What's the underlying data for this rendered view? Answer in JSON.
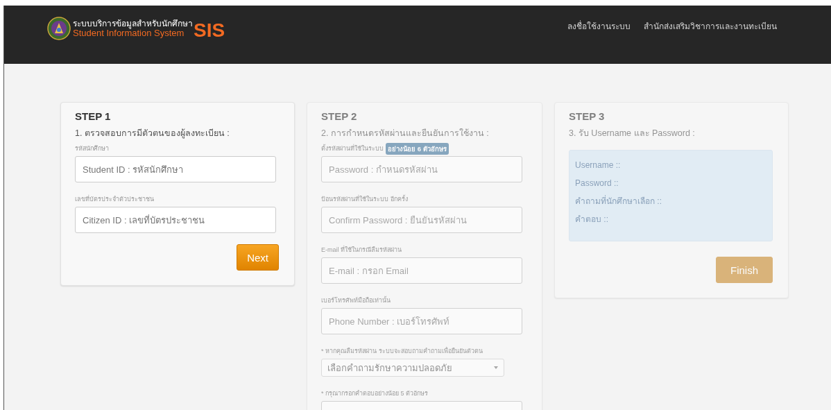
{
  "header": {
    "logo": {
      "title_th": "ระบบบริการข้อมูลสำหรับนักศึกษา",
      "title_en": "Student Information System",
      "acronym": "SIS"
    },
    "nav": [
      {
        "label": "ลงชื่อใช้งานระบบ"
      },
      {
        "label": "สำนักส่งเสริมวิชาการและงานทะเบียน"
      }
    ]
  },
  "steps": [
    {
      "title": "STEP 1",
      "subtitle": "1. ตรวจสอบการมีตัวตนของผู้ลงทะเบียน :",
      "disabled": false,
      "items": [
        {
          "kind": "input",
          "label": "รหัสนักศึกษา",
          "placeholder": "Student ID : รหัสนักศึกษา"
        },
        {
          "kind": "input",
          "label": "เลขที่บัตรประจำตัวประชาชน",
          "placeholder": "Citizen ID : เลขที่บัตรประชาชน"
        }
      ],
      "button": "Next"
    },
    {
      "title": "STEP 2",
      "subtitle": "2. การกำหนดรหัสผ่านและยืนยันการใช้งาน :",
      "disabled": true,
      "items": [
        {
          "kind": "input",
          "label": "ตั้งรหัสผ่านที่ใช้ในระบบ",
          "badge": "อย่างน้อย 6 ตัวอักษร",
          "placeholder": "Password : กำหนดรหัสผ่าน"
        },
        {
          "kind": "input",
          "label": "ป้อนรหัสผ่านที่ใช้ในระบบ อีกครั้ง",
          "placeholder": "Confirm Password : ยืนยันรหัสผ่าน"
        },
        {
          "kind": "input",
          "label": "E-mail ที่ใช้ในกรณีลืมรหัสผ่าน",
          "placeholder": "E-mail : กรอก Email"
        },
        {
          "kind": "input",
          "label": "เบอร์โทรศัพท์มือถือเท่านั้น",
          "placeholder": "Phone Number : เบอร์โทรศัพท์"
        },
        {
          "kind": "select",
          "label": "* หากคุณลืมรหัสผ่าน ระบบจะสอบถามคำถามเพื่อยืนยันตัวตน",
          "value": "เลือกคำถามรักษาความปลอดภัย"
        },
        {
          "kind": "input",
          "label": "* กรุณากรอกคำตอบอย่างน้อย 5 ตัวอักษร"
        }
      ]
    },
    {
      "title": "STEP 3",
      "subtitle": "3. รับ Username และ Password :",
      "disabled": true,
      "items": [
        {
          "kind": "info",
          "lines": [
            "Username ::",
            "Password ::",
            "คำถามที่นักศึกษาเลือก ::",
            "คำตอบ ::"
          ]
        }
      ],
      "button": "Finish"
    }
  ]
}
